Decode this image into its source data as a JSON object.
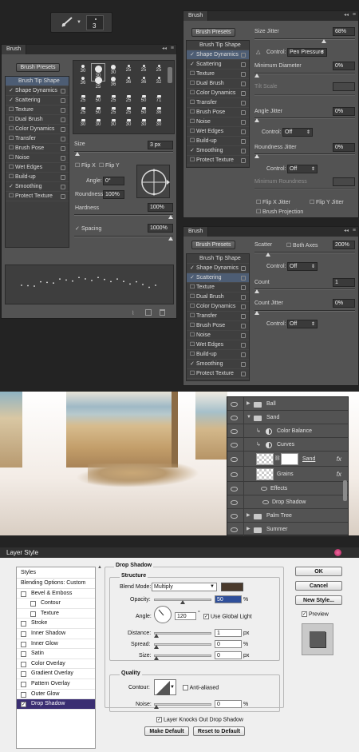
{
  "toolbar": {
    "brush_size": "3"
  },
  "panel_a": {
    "tab": "Brush",
    "presets_button": "Brush Presets",
    "items": [
      {
        "label": "Brush Tip Shape",
        "checked": false,
        "selected": true,
        "lock": false
      },
      {
        "label": "Shape Dynamics",
        "checked": true,
        "selected": false,
        "lock": true
      },
      {
        "label": "Scattering",
        "checked": true,
        "selected": false,
        "lock": true
      },
      {
        "label": "Texture",
        "checked": false,
        "selected": false,
        "lock": true
      },
      {
        "label": "Dual Brush",
        "checked": false,
        "selected": false,
        "lock": true
      },
      {
        "label": "Color Dynamics",
        "checked": false,
        "selected": false,
        "lock": true
      },
      {
        "label": "Transfer",
        "checked": false,
        "selected": false,
        "lock": true
      },
      {
        "label": "Brush Pose",
        "checked": false,
        "selected": false,
        "lock": true
      },
      {
        "label": "Noise",
        "checked": false,
        "selected": false,
        "lock": true
      },
      {
        "label": "Wet Edges",
        "checked": false,
        "selected": false,
        "lock": true
      },
      {
        "label": "Build-up",
        "checked": false,
        "selected": false,
        "lock": true
      },
      {
        "label": "Smoothing",
        "checked": true,
        "selected": false,
        "lock": true
      },
      {
        "label": "Protect Texture",
        "checked": false,
        "selected": false,
        "lock": true
      }
    ],
    "tip_sizes": [
      "30",
      "30",
      "30",
      "25",
      "25",
      "25",
      "36",
      "25",
      "36",
      "36",
      "36",
      "32",
      "25",
      "50",
      "25",
      "25",
      "50",
      "71",
      "25",
      "50",
      "25",
      "25",
      "50",
      "36",
      "30",
      "30",
      "30",
      "30",
      "30",
      "30"
    ],
    "size_label": "Size",
    "size_value": "3 px",
    "flip_x": "Flip X",
    "flip_y": "Flip Y",
    "angle_label": "Angle:",
    "angle_value": "0°",
    "roundness_label": "Roundness:",
    "roundness_value": "100%",
    "hardness_label": "Hardness",
    "hardness_value": "100%",
    "spacing_label": "Spacing",
    "spacing_value": "1000%"
  },
  "panel_b": {
    "tab": "Brush",
    "presets_button": "Brush Presets",
    "items": [
      {
        "label": "Brush Tip Shape",
        "checked": false,
        "selected": false,
        "lock": false
      },
      {
        "label": "Shape Dynamics",
        "checked": true,
        "selected": true,
        "lock": true
      },
      {
        "label": "Scattering",
        "checked": true,
        "selected": false,
        "lock": true
      },
      {
        "label": "Texture",
        "checked": false,
        "selected": false,
        "lock": true
      },
      {
        "label": "Dual Brush",
        "checked": false,
        "selected": false,
        "lock": true
      },
      {
        "label": "Color Dynamics",
        "checked": false,
        "selected": false,
        "lock": true
      },
      {
        "label": "Transfer",
        "checked": false,
        "selected": false,
        "lock": true
      },
      {
        "label": "Brush Pose",
        "checked": false,
        "selected": false,
        "lock": true
      },
      {
        "label": "Noise",
        "checked": false,
        "selected": false,
        "lock": true
      },
      {
        "label": "Wet Edges",
        "checked": false,
        "selected": false,
        "lock": true
      },
      {
        "label": "Build-up",
        "checked": false,
        "selected": false,
        "lock": true
      },
      {
        "label": "Smoothing",
        "checked": true,
        "selected": false,
        "lock": true
      },
      {
        "label": "Protect Texture",
        "checked": false,
        "selected": false,
        "lock": true
      }
    ],
    "size_jitter_label": "Size Jitter",
    "size_jitter_value": "68%",
    "control_label": "Control:",
    "control_value": "Pen Pressure",
    "min_diameter_label": "Minimum Diameter",
    "min_diameter_value": "0%",
    "tilt_scale_label": "Tilt Scale",
    "angle_jitter_label": "Angle Jitter",
    "angle_jitter_value": "0%",
    "control2_label": "Control:",
    "control2_value": "Off",
    "roundness_jitter_label": "Roundness Jitter",
    "roundness_jitter_value": "0%",
    "control3_label": "Control:",
    "control3_value": "Off",
    "min_roundness_label": "Minimum Roundness",
    "flip_x_jitter": "Flip X Jitter",
    "flip_y_jitter": "Flip Y Jitter",
    "brush_projection": "Brush Projection"
  },
  "panel_c": {
    "tab": "Brush",
    "presets_button": "Brush Presets",
    "items": [
      {
        "label": "Brush Tip Shape",
        "checked": false,
        "selected": false,
        "lock": false
      },
      {
        "label": "Shape Dynamics",
        "checked": true,
        "selected": false,
        "lock": true
      },
      {
        "label": "Scattering",
        "checked": true,
        "selected": true,
        "lock": true
      },
      {
        "label": "Texture",
        "checked": false,
        "selected": false,
        "lock": true
      },
      {
        "label": "Dual Brush",
        "checked": false,
        "selected": false,
        "lock": true
      },
      {
        "label": "Color Dynamics",
        "checked": false,
        "selected": false,
        "lock": true
      },
      {
        "label": "Transfer",
        "checked": false,
        "selected": false,
        "lock": true
      },
      {
        "label": "Brush Pose",
        "checked": false,
        "selected": false,
        "lock": true
      },
      {
        "label": "Noise",
        "checked": false,
        "selected": false,
        "lock": true
      },
      {
        "label": "Wet Edges",
        "checked": false,
        "selected": false,
        "lock": true
      },
      {
        "label": "Build-up",
        "checked": false,
        "selected": false,
        "lock": true
      },
      {
        "label": "Smoothing",
        "checked": true,
        "selected": false,
        "lock": true
      },
      {
        "label": "Protect Texture",
        "checked": false,
        "selected": false,
        "lock": true
      }
    ],
    "scatter_label": "Scatter",
    "both_axes": "Both Axes",
    "scatter_value": "200%",
    "control_label": "Control:",
    "control_value": "Off",
    "count_label": "Count",
    "count_value": "1",
    "count_jitter_label": "Count Jitter",
    "count_jitter_value": "0%",
    "control2_label": "Control:",
    "control2_value": "Off"
  },
  "layers": [
    {
      "name": "Ball",
      "type": "folder",
      "open": false,
      "indent": 0
    },
    {
      "name": "Sand",
      "type": "folder",
      "open": true,
      "indent": 0
    },
    {
      "name": "Color Balance",
      "type": "adjustment",
      "indent": 1
    },
    {
      "name": "Curves",
      "type": "adjustment",
      "indent": 1
    },
    {
      "name": "Sand",
      "type": "layer-mask",
      "indent": 1,
      "fx": true
    },
    {
      "name": "Grains",
      "type": "layer",
      "indent": 1,
      "fx": true
    },
    {
      "name": "Effects",
      "type": "effects",
      "indent": 2
    },
    {
      "name": "Drop Shadow",
      "type": "effect",
      "indent": 3
    },
    {
      "name": "Palm Tree",
      "type": "folder",
      "open": false,
      "indent": 0
    },
    {
      "name": "Summer",
      "type": "folder",
      "open": false,
      "indent": 0
    }
  ],
  "layer_style": {
    "title": "Layer Style",
    "styles_header": "Styles",
    "blending_options": "Blending Options: Custom",
    "style_items": [
      {
        "label": "Bevel & Emboss",
        "checked": false,
        "indent": 0
      },
      {
        "label": "Contour",
        "checked": false,
        "indent": 1
      },
      {
        "label": "Texture",
        "checked": false,
        "indent": 1
      },
      {
        "label": "Stroke",
        "checked": false,
        "indent": 0
      },
      {
        "label": "Inner Shadow",
        "checked": false,
        "indent": 0
      },
      {
        "label": "Inner Glow",
        "checked": false,
        "indent": 0
      },
      {
        "label": "Satin",
        "checked": false,
        "indent": 0
      },
      {
        "label": "Color Overlay",
        "checked": false,
        "indent": 0
      },
      {
        "label": "Gradient Overlay",
        "checked": false,
        "indent": 0
      },
      {
        "label": "Pattern Overlay",
        "checked": false,
        "indent": 0
      },
      {
        "label": "Outer Glow",
        "checked": false,
        "indent": 0
      },
      {
        "label": "Drop Shadow",
        "checked": true,
        "indent": 0,
        "selected": true
      }
    ],
    "section_title": "Drop Shadow",
    "structure_title": "Structure",
    "blend_mode_label": "Blend Mode:",
    "blend_mode_value": "Multiply",
    "shadow_color": "#4a3a2c",
    "opacity_label": "Opacity:",
    "opacity_value": "50",
    "opacity_unit": "%",
    "angle_label": "Angle:",
    "angle_value": "120",
    "angle_unit": "°",
    "global_light": "Use Global Light",
    "distance_label": "Distance:",
    "distance_value": "1",
    "distance_unit": "px",
    "spread_label": "Spread:",
    "spread_value": "0",
    "spread_unit": "%",
    "size_label": "Size:",
    "size_value": "0",
    "size_unit": "px",
    "quality_title": "Quality",
    "contour_label": "Contour:",
    "anti_aliased": "Anti-aliased",
    "noise_label": "Noise:",
    "noise_value": "0",
    "noise_unit": "%",
    "knocks_out": "Layer Knocks Out Drop Shadow",
    "make_default": "Make Default",
    "reset_default": "Reset to Default",
    "ok": "OK",
    "cancel": "Cancel",
    "new_style": "New Style...",
    "preview": "Preview"
  }
}
